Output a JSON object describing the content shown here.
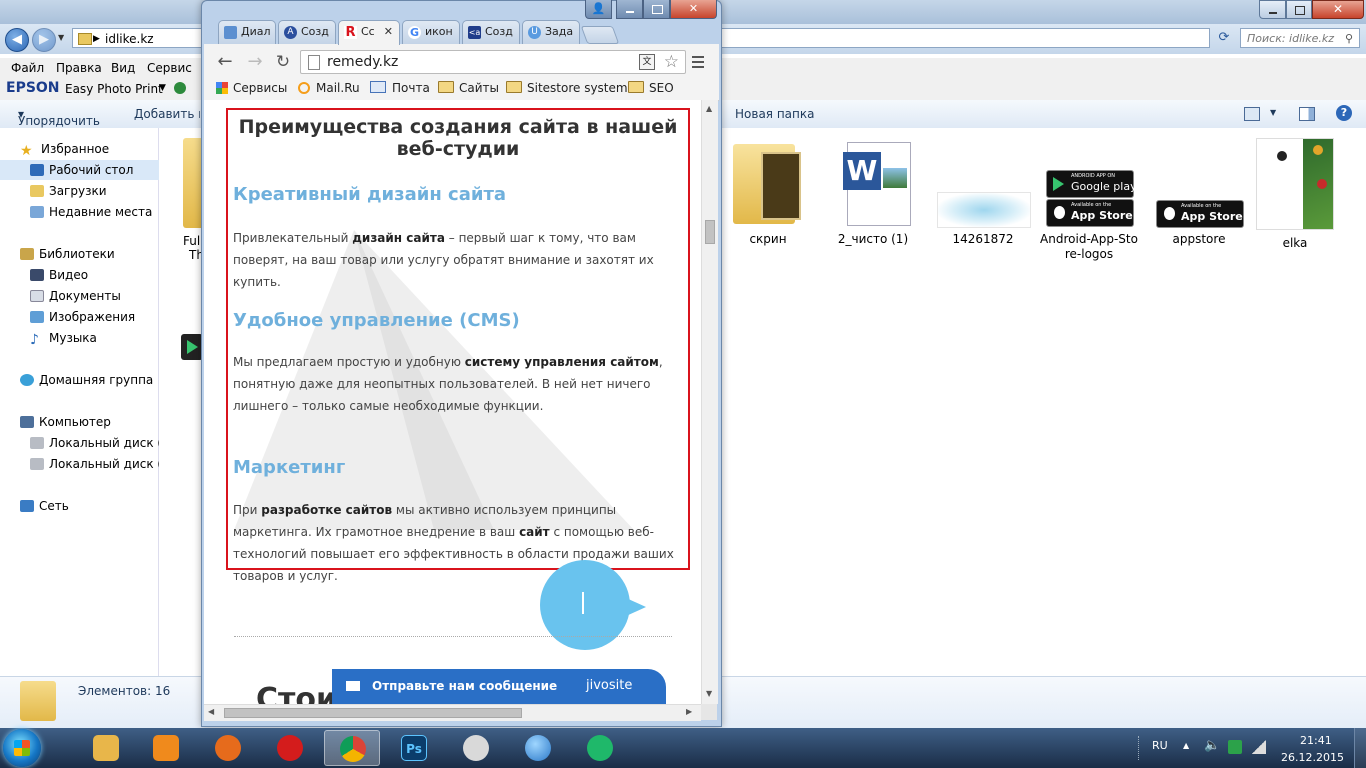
{
  "explorer": {
    "address_path": "idlike.kz",
    "search_placeholder": "Поиск: idlike.kz",
    "menu": [
      "Файл",
      "Правка",
      "Вид",
      "Сервис"
    ],
    "epson_brand": "EPSON",
    "epson_app": "Easy Photo Print",
    "toolbar": {
      "organize": "Упорядочить",
      "add_to": "Добавить в б",
      "new_folder": "Новая папка"
    },
    "nav": [
      {
        "label": "Избранное",
        "icon": "star-icon"
      },
      {
        "label": "Рабочий стол",
        "icon": "desktop-icon"
      },
      {
        "label": "Загрузки",
        "icon": "downloads-folder-icon"
      },
      {
        "label": "Недавние места",
        "icon": "recent-places-icon"
      },
      {
        "label": "Библиотеки",
        "icon": "libraries-icon"
      },
      {
        "label": "Видео",
        "icon": "video-library-icon"
      },
      {
        "label": "Документы",
        "icon": "documents-library-icon"
      },
      {
        "label": "Изображения",
        "icon": "pictures-library-icon"
      },
      {
        "label": "Музыка",
        "icon": "music-library-icon"
      },
      {
        "label": "Домашняя группа",
        "icon": "homegroup-icon"
      },
      {
        "label": "Компьютер",
        "icon": "computer-icon"
      },
      {
        "label": "Локальный диск (C:",
        "icon": "local-disk-icon"
      },
      {
        "label": "Локальный диск (F:",
        "icon": "local-disk-icon"
      },
      {
        "label": "Сеть",
        "icon": "network-icon"
      }
    ],
    "partial_files": [
      "Full",
      "Th"
    ],
    "files": [
      {
        "name": "скрин",
        "icon": "folder-icon"
      },
      {
        "name": "2_чисто (1)",
        "icon": "word-document-icon"
      },
      {
        "name": "14261872",
        "icon": "image-file-icon"
      },
      {
        "name": "Android-App-Store-logos",
        "icon": "image-file-icon"
      },
      {
        "name": "appstore",
        "icon": "image-file-icon"
      },
      {
        "name": "elka",
        "icon": "image-file-icon"
      }
    ],
    "thumb_texts": {
      "google_play_small": "ANDROID APP ON",
      "google_play": "Google play",
      "app_store_small": "Available on the",
      "app_store": "App Store"
    },
    "item_count": "Элементов: 16"
  },
  "chrome": {
    "tabs": [
      {
        "label": "Диал",
        "favicon_color": "#5b8fd0",
        "favicon_text": ""
      },
      {
        "label": "Созд",
        "favicon_color": "#2b4f9e",
        "favicon_text": "A"
      },
      {
        "label": "Сс",
        "favicon_color": "#d9131c",
        "favicon_text": "R"
      },
      {
        "label": "икон",
        "favicon_color": "#4285f4",
        "favicon_text": "G"
      },
      {
        "label": "Созд",
        "favicon_color": "#1f3c8a",
        "favicon_text": "<a"
      },
      {
        "label": "Зада",
        "favicon_color": "#5a9be0",
        "favicon_text": "U"
      }
    ],
    "url": "remedy.kz",
    "bookmarks": [
      "Сервисы",
      "Mail.Ru",
      "Почта",
      "Сайты",
      "Sitestore systems",
      "SEO"
    ]
  },
  "page": {
    "heading": "Преимущества создания сайта в нашей веб-студии",
    "sections": [
      {
        "title": "Креативный дизайн сайта",
        "text_before": "Привлекательный ",
        "bold": "дизайн сайта",
        "text_after": " – первый шаг к тому, что вам поверят, на ваш товар или услугу обратят внимание и захотят их купить."
      },
      {
        "title": "Удобное управление (CMS)",
        "text_before": "Мы предлагаем простую и удобную ",
        "bold": "систему управления сайтом",
        "text_after": ", понятную даже для неопытных пользователей. В ней нет ничего лишнего – только самые необходимые функции."
      },
      {
        "title": "Маркетинг",
        "text_before": "При ",
        "bold": "разработке сайтов",
        "text_middle": " мы активно используем принципы маркетинга. Их грамотное внедрение в ваш ",
        "bold2": "сайт",
        "text_after": " с помощью веб-технологий повышает его эффективность в области продажи ваших товаров и услуг."
      }
    ],
    "next_heading_partial": "Стои",
    "chat_label": "Отправьте нам сообщение",
    "chat_brand": "jivosite"
  },
  "taskbar": {
    "apps": [
      {
        "name": "explorer",
        "icon": "explorer-icon",
        "color": "#e8b64a"
      },
      {
        "name": "media",
        "icon": "media-player-icon",
        "color": "#f08a1c"
      },
      {
        "name": "firefox",
        "icon": "firefox-icon",
        "color": "#e66b1c"
      },
      {
        "name": "opera",
        "icon": "opera-icon",
        "color": "#d41c1c"
      },
      {
        "name": "chrome",
        "icon": "chrome-icon",
        "color": "#3b9e3b"
      },
      {
        "name": "photoshop",
        "icon": "photoshop-icon",
        "color": "#0b3d6b"
      },
      {
        "name": "paint",
        "icon": "paint-icon",
        "color": "#d9d9d9"
      },
      {
        "name": "browser",
        "icon": "globe-icon",
        "color": "#2a78c8"
      },
      {
        "name": "atom",
        "icon": "atom-icon",
        "color": "#1fb86a"
      }
    ],
    "lang": "RU",
    "time": "21:41",
    "date": "26.12.2015"
  }
}
